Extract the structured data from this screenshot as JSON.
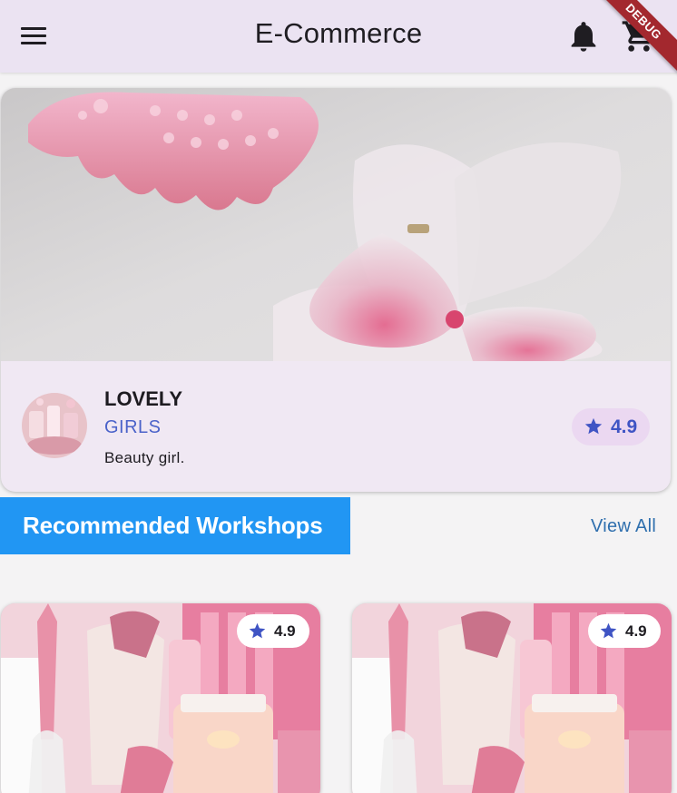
{
  "app_bar": {
    "title": "E-Commerce",
    "menu_icon": "hamburger-menu-icon",
    "notification_icon": "bell-icon",
    "cart_icon": "shopping-cart-icon",
    "background": "#ebe3f2"
  },
  "debug_banner": "DEBUG",
  "featured": {
    "name": "LOVELY",
    "category": "GIRLS",
    "description": "Beauty girl.",
    "rating": "4.9",
    "rating_icon": "star-icon",
    "accent": "#4a62c9"
  },
  "section": {
    "title": "Recommended Workshops",
    "view_all": "View All",
    "accent": "#2196f3"
  },
  "workshops": [
    {
      "rating": "4.9",
      "rating_icon": "star-icon"
    },
    {
      "rating": "4.9",
      "rating_icon": "star-icon"
    }
  ]
}
